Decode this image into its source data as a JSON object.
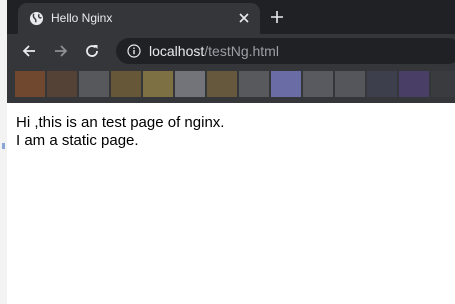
{
  "tab": {
    "title": "Hello Nginx"
  },
  "address_bar": {
    "host": "localhost",
    "path": "/testNg.html"
  },
  "page": {
    "lines": [
      "Hi ,this is an test page of nginx.",
      "I am a static page."
    ]
  },
  "bookmarks_bar": {
    "note": "",
    "pixel_colors": [
      "#7a4a2e",
      "#5a4436",
      "#5c5e63",
      "#6e5d3a",
      "#8a7a44",
      "#7e7e86",
      "#6d5e3e",
      "#5d5f64",
      "#7375b8",
      "#5e6066",
      "#5a5c61",
      "#3f4150",
      "#4b3f6e",
      "#3a3c41"
    ]
  }
}
